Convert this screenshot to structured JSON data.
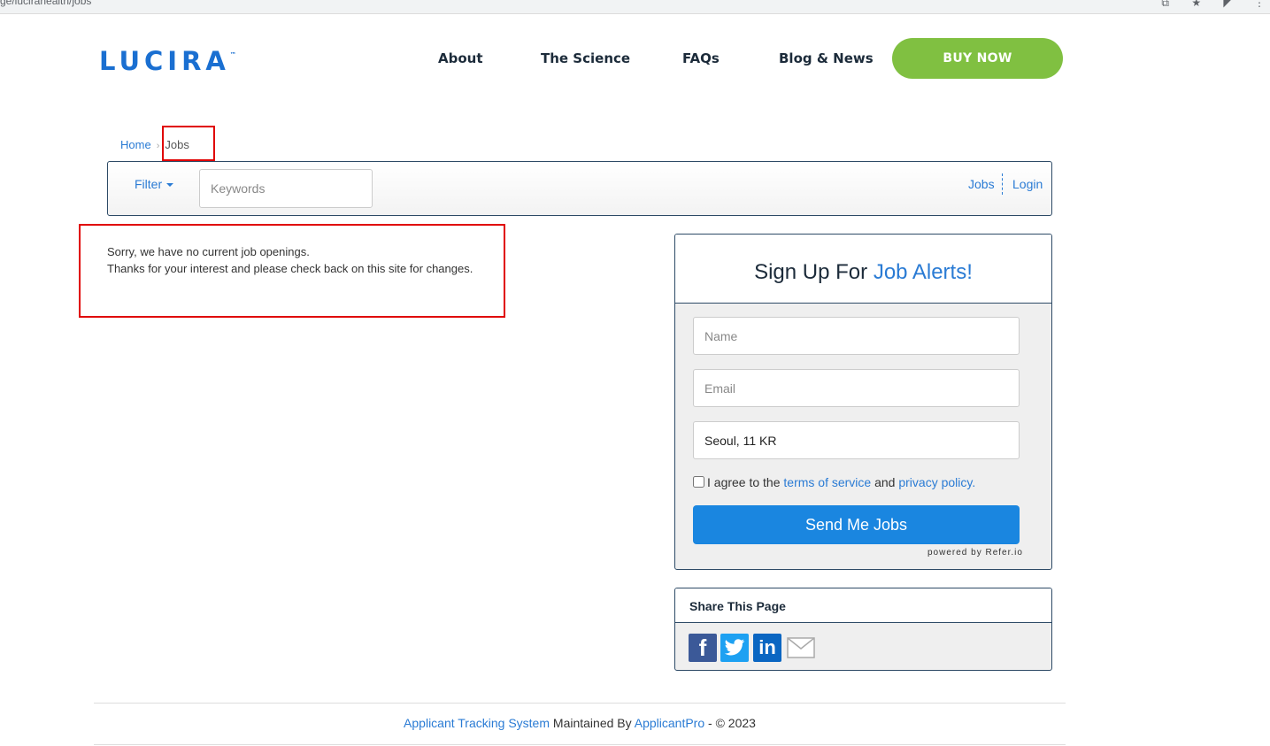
{
  "browser": {
    "url_fragment": "ge/lucirahealth/jobs"
  },
  "header": {
    "logo_text": "LUCIRA",
    "logo_tm": "™",
    "nav": {
      "about": "About",
      "science": "The Science",
      "faqs": "FAQs",
      "blog": "Blog & News"
    },
    "buy_now": "BUY NOW"
  },
  "breadcrumb": {
    "home": "Home",
    "separator": "›",
    "current": "Jobs"
  },
  "filter_bar": {
    "filter_label": "Filter",
    "keywords_placeholder": "Keywords",
    "jobs_link": "Jobs",
    "login_link": "Login"
  },
  "message": {
    "line1": "Sorry, we have no current job openings.",
    "line2": "Thanks for your interest and please check back on this site for changes."
  },
  "signup": {
    "title_prefix": "Sign Up For",
    "title_accent": "Job Alerts!",
    "name_placeholder": "Name",
    "email_placeholder": "Email",
    "location_value": "Seoul, 11 KR",
    "agree_prefix": "I agree to the",
    "terms_link": "terms of service",
    "agree_and": "and",
    "privacy_link": "privacy policy.",
    "send_button": "Send Me Jobs",
    "powered_by": "powered by Refer.io"
  },
  "share": {
    "title": "Share This Page",
    "icons": [
      "facebook-icon",
      "twitter-icon",
      "linkedin-icon",
      "email-icon"
    ]
  },
  "footer": {
    "ats_link": "Applicant Tracking System",
    "maintained_by": "Maintained By",
    "applicantpro_link": "ApplicantPro",
    "copyright": "- © 2023"
  },
  "colors": {
    "brand_blue": "#1a6fd1",
    "link_blue": "#2a7bd4",
    "buy_green": "#80c041",
    "send_blue": "#1a86e0",
    "highlight_red": "#e00000"
  }
}
